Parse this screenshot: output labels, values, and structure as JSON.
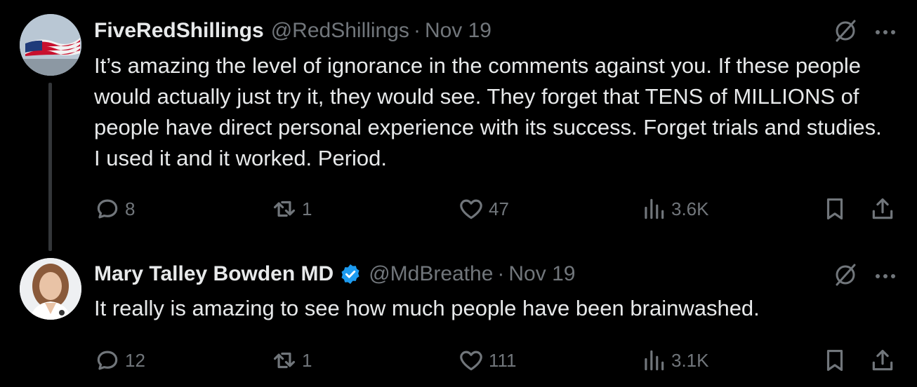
{
  "tweets": [
    {
      "author_name": "FiveRedShillings",
      "handle": "@RedShillings",
      "separator": "·",
      "date": "Nov 19",
      "verified": false,
      "text": "It’s amazing the level of ignorance in the comments against you. If these people would actually just try it, they would see. They forget that TENS of MILLIONS of people have direct personal experience with its success. Forget trials and studies. I used it and it worked. Period.",
      "replies": "8",
      "reposts": "1",
      "likes": "47",
      "views": "3.6K",
      "avatar_icon": "american-flag-avatar"
    },
    {
      "author_name": "Mary Talley Bowden MD",
      "handle": "@MdBreathe",
      "separator": "·",
      "date": "Nov 19",
      "verified": true,
      "text": "It really is amazing to see how much people have been brainwashed.",
      "replies": "12",
      "reposts": "1",
      "likes": "111",
      "views": "3.1K",
      "avatar_icon": "woman-portrait-avatar"
    }
  ],
  "colors": {
    "background": "#000000",
    "primary_text": "#e7e9ea",
    "secondary_text": "#71767b",
    "verified_badge": "#1d9bf0",
    "thread_line": "#333639"
  }
}
